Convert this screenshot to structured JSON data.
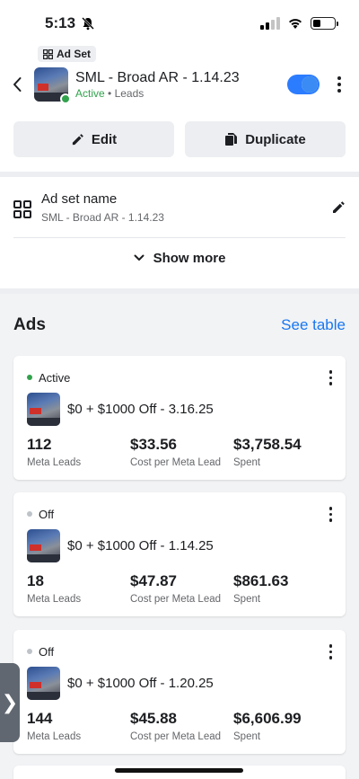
{
  "status_bar": {
    "time": "5:13",
    "icons": [
      "bell-slash-icon",
      "signal-icon",
      "wifi-icon",
      "battery-icon"
    ],
    "battery_level": 0.35
  },
  "header": {
    "tag_label": "Ad Set",
    "title": "SML - Broad AR - 1.14.23",
    "status": "Active",
    "separator": "•",
    "objective": "Leads",
    "toggle_on": true
  },
  "actions": {
    "edit_label": "Edit",
    "duplicate_label": "Duplicate"
  },
  "ad_set_name": {
    "label": "Ad set name",
    "value": "SML - Broad AR - 1.14.23"
  },
  "show_more_label": "Show more",
  "ads": {
    "title": "Ads",
    "see_table_label": "See table",
    "items": [
      {
        "status": "Active",
        "status_color": "#31a24c",
        "name": "$0 + $1000 Off - 3.16.25",
        "metrics": [
          {
            "value": "112",
            "label": "Meta Leads"
          },
          {
            "value": "$33.56",
            "label": "Cost per Meta Lead"
          },
          {
            "value": "$3,758.54",
            "label": "Spent"
          }
        ]
      },
      {
        "status": "Off",
        "status_color": "#bec3c9",
        "name": "$0 + $1000 Off - 1.14.25",
        "metrics": [
          {
            "value": "18",
            "label": "Meta Leads"
          },
          {
            "value": "$47.87",
            "label": "Cost per Meta Lead"
          },
          {
            "value": "$861.63",
            "label": "Spent"
          }
        ]
      },
      {
        "status": "Off",
        "status_color": "#bec3c9",
        "name": "$0 + $1000 Off - 1.20.25",
        "metrics": [
          {
            "value": "144",
            "label": "Meta Leads"
          },
          {
            "value": "$45.88",
            "label": "Cost per Meta Lead"
          },
          {
            "value": "$6,606.99",
            "label": "Spent"
          }
        ]
      }
    ]
  },
  "side_handle_glyph": "❯",
  "colors": {
    "accent": "#1877f2",
    "active": "#31a24c",
    "background": "#f2f3f5"
  }
}
